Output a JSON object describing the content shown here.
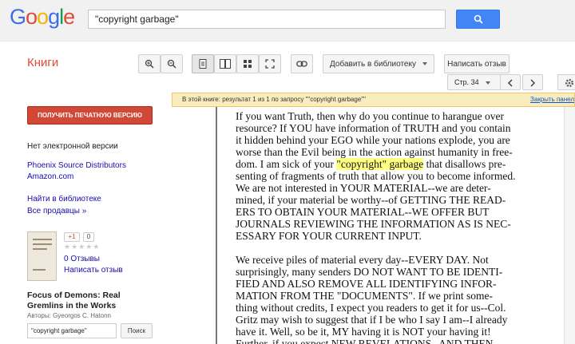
{
  "header": {
    "logo": [
      "G",
      "o",
      "o",
      "g",
      "l",
      "e"
    ],
    "search_value": "\"copyright garbage\"",
    "search_icon": "search-icon"
  },
  "toolbar": {
    "section_title": "Книги",
    "add_to_library": "Добавить в библиотеку",
    "write_review": "Написать отзыв",
    "page_label": "Стр. 34",
    "icons": [
      "zoom-in-icon",
      "zoom-out-icon",
      "single-page-icon",
      "two-page-icon",
      "thumbnail-grid-icon",
      "fullscreen-icon",
      "link-icon",
      "chevron-left-icon",
      "chevron-right-icon",
      "gear-icon"
    ]
  },
  "infobar": {
    "text": "В этой книге: результат 1 из 1 по запросу \"\"copyright garbage\"\"",
    "close_label": "Закрыть панел"
  },
  "sidebar": {
    "print_button": "ПОЛУЧИТЬ ПЕЧАТНУЮ ВЕРСИЮ",
    "no_ebook": "Нет электронной версии",
    "sellers": [
      "Phoenix Source Distributors",
      "Amazon.com"
    ],
    "find_in_library": "Найти в библиотеке",
    "all_sellers": "Все продавцы »",
    "gplus": "+1",
    "gplus_count": "0",
    "stars": "★★★★★",
    "reviews_count": "0 Отзывы",
    "write_review": "Написать отзыв",
    "book_title_line1": "Focus of Demons: Real",
    "book_title_line2": "Gremlins in the Works",
    "authors": "Авторы: Gyeorgos C. Hatonn",
    "search_value": "\"copyright garbage\"",
    "search_button": "Поиск"
  },
  "page_text": {
    "p1_lines": [
      "If you want Truth, then why do you continue to harangue over",
      "resource? If YOU have information of TRUTH and you contain",
      "it hidden behind your EGO while your nations explode, you are",
      "worse than the Evil being in the action against humanity in free-"
    ],
    "p1_hl_before": "dom. I am sick of your ",
    "p1_hl": "\"copyright\" garbage",
    "p1_hl_after": " that disallows pre-",
    "p1_rest": [
      "senting of fragments of truth that allow you to become informed.",
      "We are not interested in YOUR MATERIAL--we are deter-",
      "mined, if your material be worthy--of GETTING THE READ-",
      "ERS TO OBTAIN YOUR MATERIAL--WE OFFER BUT",
      "JOURNALS REVIEWING THE INFORMATION AS IS NEC-",
      "ESSARY FOR YOUR CURRENT INPUT."
    ],
    "p2_lines": [
      "We receive piles of material every day--EVERY DAY.  Not",
      "surprisingly, many senders DO NOT WANT TO BE IDENTI-",
      "FIED AND ALSO REMOVE ALL IDENTIFYING INFOR-",
      "MATION FROM THE \"DOCUMENTS\".  If we print some-",
      "thing without credits, I expect you readers to get it for us--Col.",
      "Gritz may wish to suggest that if I be who I say I am--I already",
      "have it.  Well, so be it, MY having it is NOT your having it!",
      "Further, if you expect NEW REVELATIONS--AND THEN"
    ]
  }
}
